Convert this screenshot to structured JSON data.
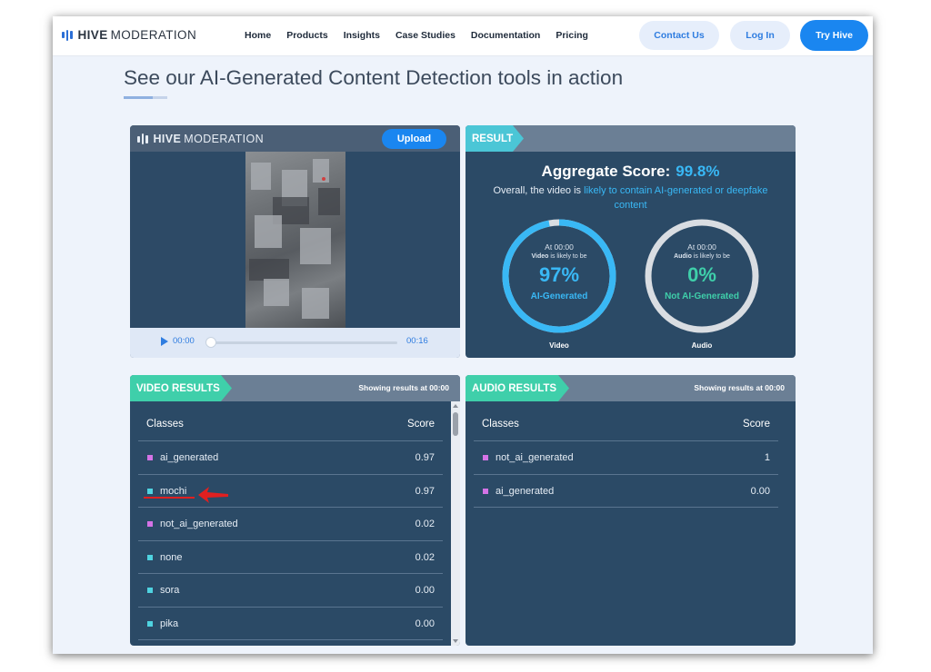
{
  "nav": {
    "logo_bold": "HIVE",
    "logo_rest": "MODERATION",
    "links": [
      "Home",
      "Products",
      "Insights",
      "Case Studies",
      "Documentation",
      "Pricing"
    ],
    "contact_label": "Contact Us",
    "login_label": "Log In",
    "try_label": "Try Hive"
  },
  "heading": "See our AI-Generated Content Detection tools in action",
  "player": {
    "logo_bold": "HIVE",
    "logo_rest": "MODERATION",
    "upload_label": "Upload",
    "time_current": "00:00",
    "time_total": "00:16",
    "progress": 0
  },
  "result": {
    "tag": "RESULT",
    "aggregate_label": "Aggregate Score:",
    "aggregate_value": "99.8%",
    "overall_prefix": "Overall, the video is",
    "overall_highlight": "likely to contain AI-generated or deepfake content",
    "video_gauge": {
      "at": "At 00:00",
      "likely_bold": "Video",
      "likely_rest": "is likely to be",
      "percent": "97%",
      "value": 0.97,
      "label": "AI-Generated",
      "caption": "Video",
      "color": "#39b8f5"
    },
    "audio_gauge": {
      "at": "At 00:00",
      "likely_bold": "Audio",
      "likely_rest": "is likely to be",
      "percent": "0%",
      "value": 0,
      "label": "Not AI-Generated",
      "caption": "Audio",
      "color": "#3fcfaa"
    }
  },
  "video_results": {
    "tag": "VIDEO RESULTS",
    "showing": "Showing results at 00:00",
    "col_classes": "Classes",
    "col_score": "Score",
    "rows": [
      {
        "name": "ai_generated",
        "score": "0.97",
        "color": "#d473e6"
      },
      {
        "name": "mochi",
        "score": "0.97",
        "color": "#4fd3e0"
      },
      {
        "name": "not_ai_generated",
        "score": "0.02",
        "color": "#d473e6"
      },
      {
        "name": "none",
        "score": "0.02",
        "color": "#4fd3e0"
      },
      {
        "name": "sora",
        "score": "0.00",
        "color": "#4fd3e0"
      },
      {
        "name": "pika",
        "score": "0.00",
        "color": "#4fd3e0"
      }
    ]
  },
  "audio_results": {
    "tag": "AUDIO RESULTS",
    "showing": "Showing results at 00:00",
    "col_classes": "Classes",
    "col_score": "Score",
    "rows": [
      {
        "name": "not_ai_generated",
        "score": "1",
        "color": "#d473e6"
      },
      {
        "name": "ai_generated",
        "score": "0.00",
        "color": "#d473e6"
      }
    ]
  },
  "colors": {
    "accent": "#1a86f0",
    "panel": "#2b4a66",
    "highlight": "#39b8f5",
    "annotation": "#e02020"
  }
}
